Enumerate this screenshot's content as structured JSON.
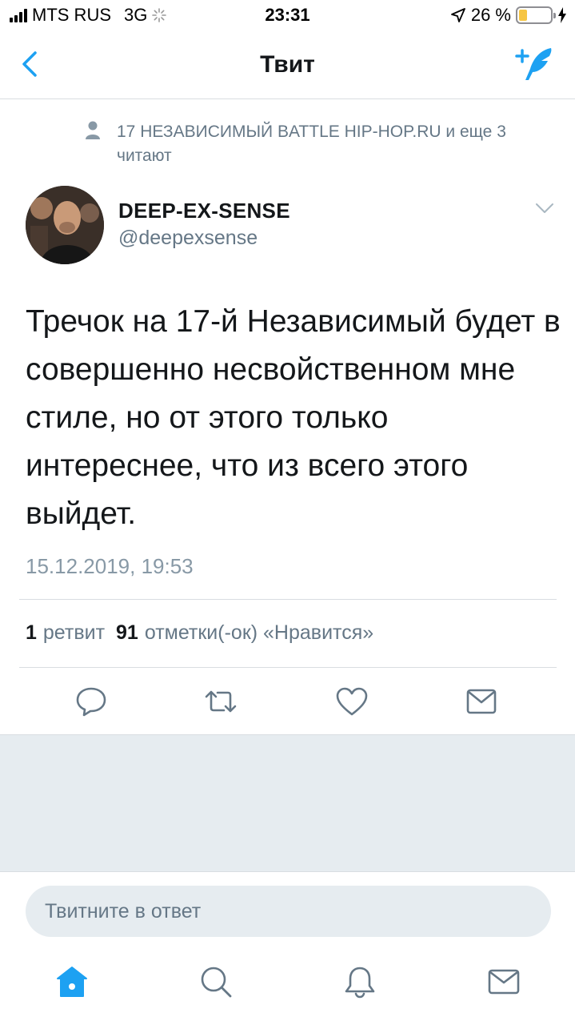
{
  "status_bar": {
    "carrier": "MTS RUS",
    "network": "3G",
    "time": "23:31",
    "battery": "26 %",
    "battery_level": 0.26,
    "battery_color": "#f6c543"
  },
  "nav": {
    "back_icon": "chevron-left-icon",
    "title": "Твит",
    "compose_icon": "compose-tweet-icon",
    "accent_color": "#1da1f2"
  },
  "context": {
    "icon": "person-icon",
    "text": "17 НЕЗАВИСИМЫЙ BATTLE HIP-HOP.RU и еще 3 читают"
  },
  "author": {
    "name": "DEEP-EX-SENSE",
    "handle": "@deepexsense"
  },
  "tweet": {
    "text": "Тречок на 17-й Независимый будет в совершенно несвойственном мне стиле, но от этого только интереснее, что из всего этого выйдет.",
    "timestamp": "15.12.2019, 19:53"
  },
  "stats": {
    "retweets_count": "1",
    "retweets_label": "ретвит",
    "likes_count": "91",
    "likes_label": "отметки(-ок) «Нравится»"
  },
  "actions": [
    {
      "icon": "reply-icon"
    },
    {
      "icon": "retweet-icon"
    },
    {
      "icon": "heart-icon"
    },
    {
      "icon": "share-envelope-icon"
    }
  ],
  "reply": {
    "placeholder": "Твитните в ответ"
  },
  "tabbar": [
    {
      "icon": "home-icon",
      "active": true
    },
    {
      "icon": "search-icon",
      "active": false
    },
    {
      "icon": "notifications-bell-icon",
      "active": false
    },
    {
      "icon": "messages-envelope-icon",
      "active": false
    }
  ]
}
